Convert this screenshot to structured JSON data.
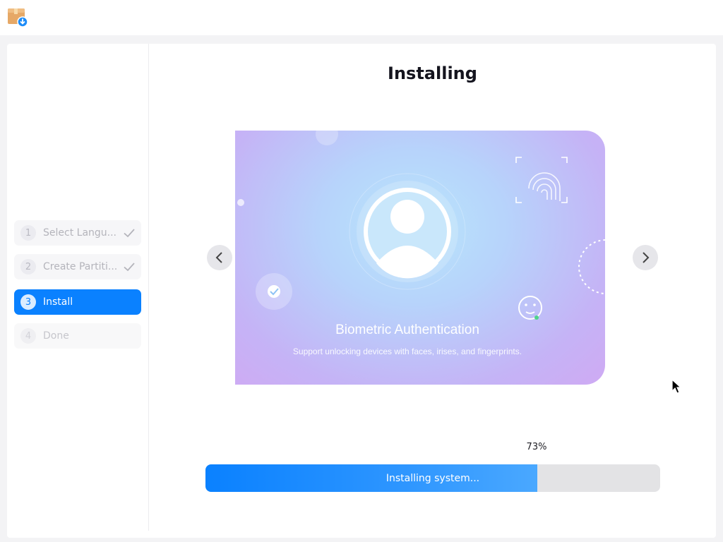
{
  "titlebar": {
    "icon": "installer-package-icon"
  },
  "sidebar": {
    "steps": [
      {
        "number": "1",
        "label": "Select Langu...",
        "state": "completed"
      },
      {
        "number": "2",
        "label": "Create Partiti...",
        "state": "completed"
      },
      {
        "number": "3",
        "label": "Install",
        "state": "active"
      },
      {
        "number": "4",
        "label": "Done",
        "state": "pending"
      }
    ]
  },
  "main": {
    "title": "Installing",
    "slide": {
      "title": "Biometric Authentication",
      "subtitle": "Support unlocking devices with faces, irises, and fingerprints."
    },
    "progress": {
      "percent_label": "73%",
      "value": 73,
      "status": "Installing system..."
    }
  },
  "colors": {
    "accent": "#0a81ff",
    "track": "#e3e3e5"
  }
}
